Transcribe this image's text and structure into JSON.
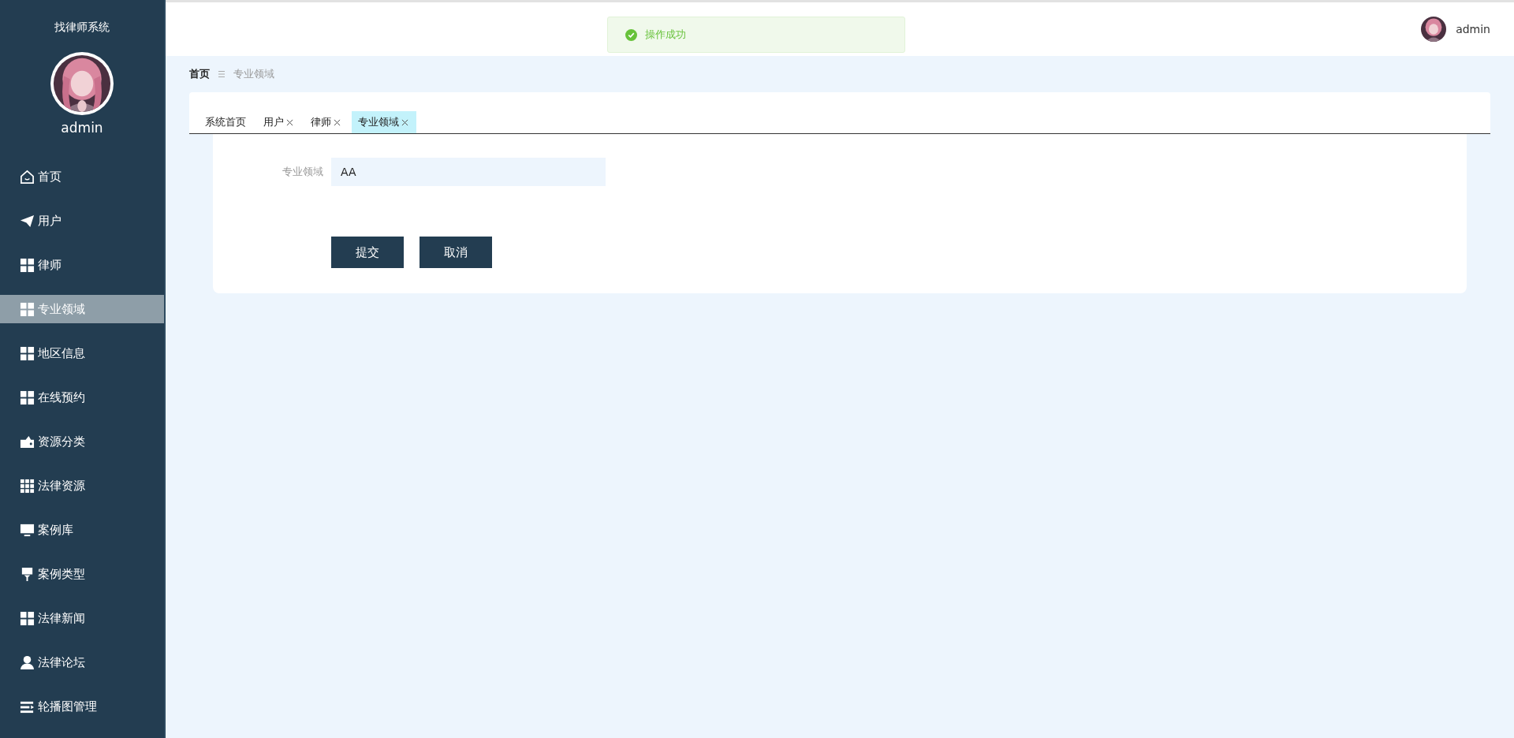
{
  "sidebar": {
    "title": "找律师系统",
    "user": "admin",
    "items": [
      {
        "label": "首页",
        "kind": "home",
        "selected": false
      },
      {
        "label": "用户",
        "kind": "plane",
        "selected": false
      },
      {
        "label": "律师",
        "kind": "grid",
        "selected": false
      },
      {
        "label": "专业领域",
        "kind": "grid",
        "selected": true
      },
      {
        "label": "地区信息",
        "kind": "grid",
        "selected": false
      },
      {
        "label": "在线预约",
        "kind": "grid",
        "selected": false
      },
      {
        "label": "资源分类",
        "kind": "wallet",
        "selected": false
      },
      {
        "label": "法律资源",
        "kind": "grid9",
        "selected": false
      },
      {
        "label": "案例库",
        "kind": "monitor",
        "selected": false
      },
      {
        "label": "案例类型",
        "kind": "brush",
        "selected": false
      },
      {
        "label": "法律新闻",
        "kind": "grid",
        "selected": false
      },
      {
        "label": "法律论坛",
        "kind": "person",
        "selected": false
      },
      {
        "label": "轮播图管理",
        "kind": "list",
        "selected": false
      }
    ]
  },
  "header": {
    "user": "admin"
  },
  "toast": {
    "message": "操作成功"
  },
  "breadcrumb": [
    "首页",
    "专业领域"
  ],
  "tabs": [
    {
      "label": "系统首页",
      "closable": false,
      "selected": false
    },
    {
      "label": "用户",
      "closable": true,
      "selected": false
    },
    {
      "label": "律师",
      "closable": true,
      "selected": false
    },
    {
      "label": "专业领域",
      "closable": true,
      "selected": true
    }
  ],
  "form": {
    "fields": [
      {
        "label": "专业领域",
        "value": "AA"
      }
    ],
    "buttons": [
      "提交",
      "取消"
    ]
  }
}
